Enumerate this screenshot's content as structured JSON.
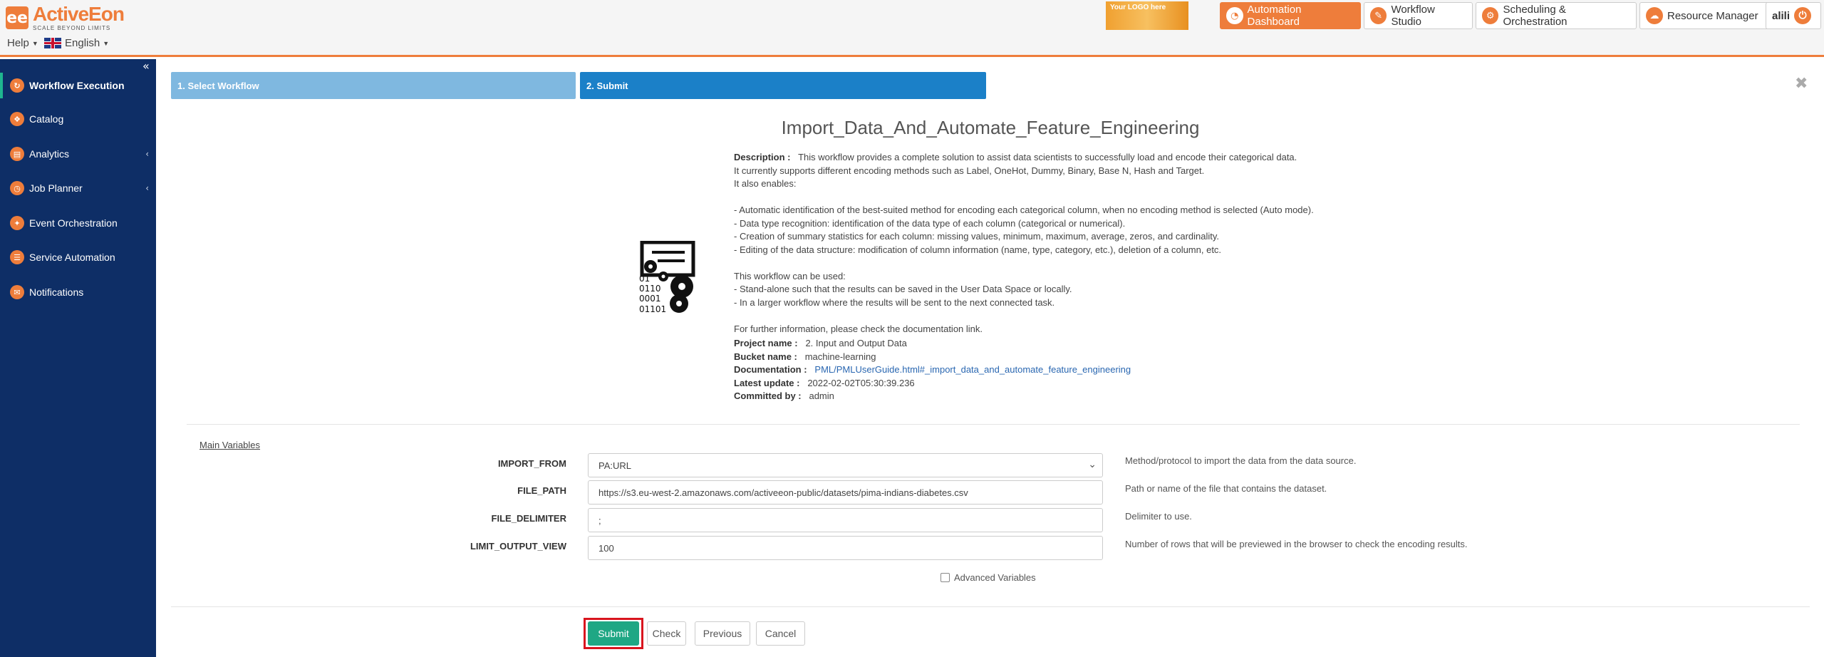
{
  "header": {
    "brand_name": "ActiveEon",
    "brand_tagline": "SCALE BEYOND LIMITS",
    "help_label": "Help",
    "language_label": "English",
    "your_logo_text": "Your LOGO here",
    "portals": [
      {
        "label": "Automation Dashboard",
        "icon": "dashboard-icon"
      },
      {
        "label": "Workflow Studio",
        "icon": "studio-icon"
      },
      {
        "label": "Scheduling & Orchestration",
        "icon": "scheduler-icon"
      },
      {
        "label": "Resource Manager",
        "icon": "cloud-icon"
      }
    ],
    "user": "alili",
    "brand_color": "#ee7d3b"
  },
  "sidebar": {
    "items": [
      {
        "label": "Workflow Execution",
        "icon": "workflow-execution-icon",
        "active": true
      },
      {
        "label": "Catalog",
        "icon": "catalog-icon"
      },
      {
        "label": "Analytics",
        "icon": "analytics-icon",
        "has_submenu": true
      },
      {
        "label": "Job Planner",
        "icon": "job-planner-icon",
        "has_submenu": true
      },
      {
        "label": "Event Orchestration",
        "icon": "event-orchestration-icon"
      },
      {
        "label": "Service Automation",
        "icon": "service-automation-icon"
      },
      {
        "label": "Notifications",
        "icon": "notifications-icon"
      }
    ],
    "background": "#0e2e66"
  },
  "wizard": {
    "step1": "1. Select Workflow",
    "step2": "2. Submit"
  },
  "workflow": {
    "title": "Import_Data_And_Automate_Feature_Engineering",
    "description_label": "Description :",
    "description_lines": [
      "This workflow provides a complete solution to assist data scientists to successfully load and encode their categorical data.",
      "It currently supports different encoding methods such as Label, OneHot, Dummy, Binary, Base N, Hash and Target.",
      "It also enables:",
      "",
      "- Automatic identification of the best-suited method for encoding each categorical column, when no encoding method is selected (Auto mode).",
      "- Data type recognition: identification of the data type of each column (categorical or numerical).",
      "- Creation of summary statistics for each column: missing values, minimum, maximum, average, zeros, and cardinality.",
      "- Editing of the data structure: modification of column information (name, type, category, etc.), deletion of a column, etc.",
      "",
      "This workflow can be used:",
      "- Stand-alone such that the results can be saved in the User Data Space or locally.",
      "- In a larger workflow where the results will be sent to the next connected task.",
      "",
      "For further information, please check the documentation link."
    ],
    "project_label": "Project name :",
    "project_name": "2. Input and Output Data",
    "bucket_label": "Bucket name :",
    "bucket_name": "machine-learning",
    "documentation_label": "Documentation :",
    "documentation_link": "PML/PMLUserGuide.html#_import_data_and_automate_feature_engineering",
    "latest_update_label": "Latest update :",
    "latest_update": "2022-02-02T05:30:39.236",
    "committed_by_label": "Committed by :",
    "committed_by": "admin"
  },
  "variables": {
    "section_title": "Main Variables",
    "items": [
      {
        "name": "IMPORT_FROM",
        "value": "PA:URL",
        "type": "select",
        "help": "Method/protocol to import the data from the data source."
      },
      {
        "name": "FILE_PATH",
        "value": "https://s3.eu-west-2.amazonaws.com/activeeon-public/datasets/pima-indians-diabetes.csv",
        "type": "text",
        "help": "Path or name of the file that contains the dataset."
      },
      {
        "name": "FILE_DELIMITER",
        "value": ";",
        "type": "text",
        "help": "Delimiter to use."
      },
      {
        "name": "LIMIT_OUTPUT_VIEW",
        "value": "100",
        "type": "text",
        "help": "Number of rows that will be previewed in the browser to check the encoding results."
      }
    ],
    "advanced_label": "Advanced Variables"
  },
  "actions": {
    "submit": "Submit",
    "check": "Check",
    "previous": "Previous",
    "cancel": "Cancel",
    "submit_color": "#1fa784",
    "highlight_color": "#d9151e"
  }
}
